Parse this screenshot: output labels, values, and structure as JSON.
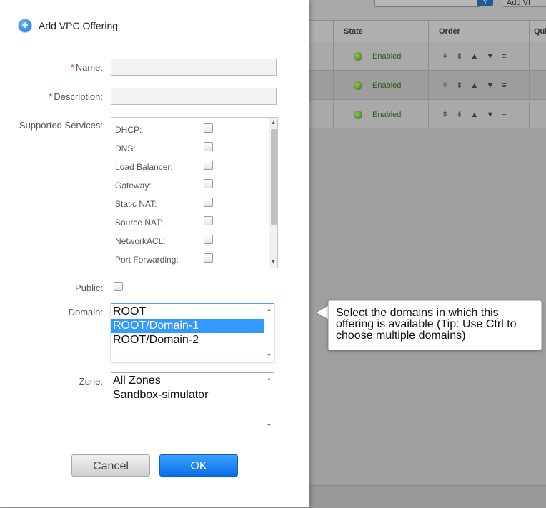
{
  "background": {
    "search_icon": "search-icon",
    "add_button_label": "Add VI",
    "columns": [
      "State",
      "Order",
      "Qui"
    ],
    "rows": [
      {
        "state": "Enabled"
      },
      {
        "state": "Enabled"
      },
      {
        "state": "Enabled"
      }
    ],
    "order_icons": [
      "move-top-icon",
      "move-bottom-icon",
      "move-up-icon",
      "move-down-icon",
      "drag-icon"
    ]
  },
  "dialog": {
    "title": "Add VPC Offering",
    "icon": "plus-circle-icon",
    "fields": {
      "name_label": "Name:",
      "description_label": "Description:",
      "supported_services_label": "Supported Services:",
      "public_label": "Public:",
      "domain_label": "Domain:",
      "zone_label": "Zone:",
      "name_value": "",
      "description_value": ""
    },
    "services": [
      {
        "label": "DHCP:",
        "checked": false
      },
      {
        "label": "DNS:",
        "checked": false
      },
      {
        "label": "Load Balancer:",
        "checked": false
      },
      {
        "label": "Gateway:",
        "checked": false
      },
      {
        "label": "Static NAT:",
        "checked": false
      },
      {
        "label": "Source NAT:",
        "checked": false
      },
      {
        "label": "NetworkACL:",
        "checked": false
      },
      {
        "label": "Port Forwarding:",
        "checked": false
      }
    ],
    "public_checked": false,
    "domains": [
      {
        "label": "ROOT",
        "selected": false
      },
      {
        "label": "ROOT/Domain-1",
        "selected": true
      },
      {
        "label": "ROOT/Domain-2",
        "selected": false
      }
    ],
    "zones": [
      {
        "label": "All Zones",
        "selected": false
      },
      {
        "label": "Sandbox-simulator",
        "selected": false
      }
    ],
    "buttons": {
      "cancel": "Cancel",
      "ok": "OK"
    }
  },
  "tooltip": {
    "text": "Select the domains in which this offering is available (Tip: Use Ctrl to choose multiple domains)"
  },
  "colors": {
    "ok_button": "#0a6fe8",
    "selected_option": "#3399ff",
    "required_asterisk": "#d32020",
    "enabled_state": "#2d5a1b"
  }
}
